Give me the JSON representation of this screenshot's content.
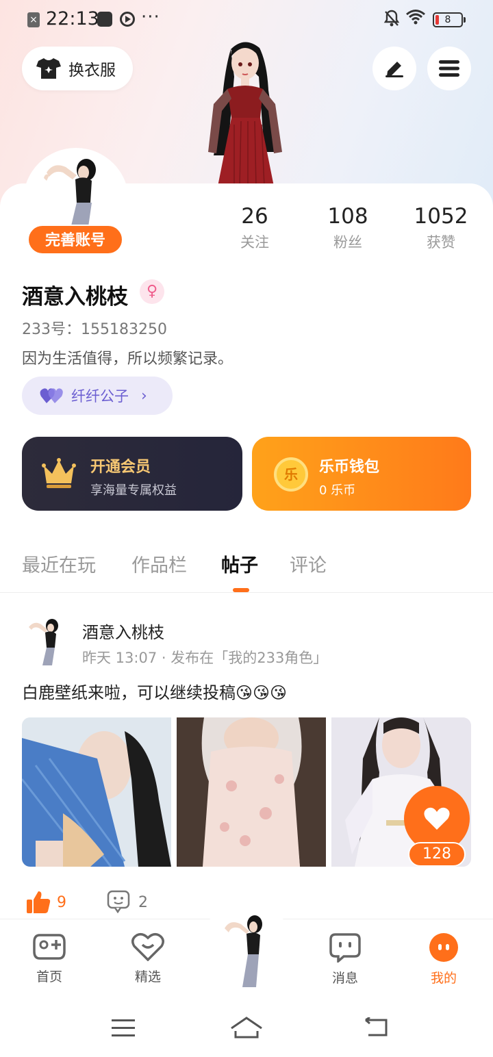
{
  "status_bar": {
    "time": "22:13",
    "dots": "···",
    "battery": "8"
  },
  "header": {
    "outfit_label": "换衣服",
    "edit_icon": "pencil-icon",
    "menu_icon": "hamburger-icon"
  },
  "profile": {
    "complete_account": "完善账号",
    "stats": [
      {
        "num": "26",
        "label": "关注"
      },
      {
        "num": "108",
        "label": "粉丝"
      },
      {
        "num": "1052",
        "label": "获赞"
      }
    ],
    "username": "酒意入桃枝",
    "gender_symbol": "♀",
    "uid": "233号：155183250",
    "bio": "因为生活值得，所以频繁记录。",
    "cp_label": "纤纤公子",
    "cp_chevron": "›"
  },
  "vip": {
    "title": "开通会员",
    "subtitle": "享海量专属权益"
  },
  "wallet": {
    "coin_char": "乐",
    "title": "乐币钱包",
    "subtitle": "0 乐币"
  },
  "tabs": [
    {
      "label": "最近在玩",
      "active": false
    },
    {
      "label": "作品栏",
      "active": false
    },
    {
      "label": "帖子",
      "active": true
    },
    {
      "label": "评论",
      "active": false
    }
  ],
  "post": {
    "author": "酒意入桃枝",
    "meta": "昨天 13:07 · 发布在「我的233角色」",
    "text": "白鹿壁纸来啦，可以继续投稿😘😘😘",
    "like_fab_count": "128",
    "likes": "9",
    "comments": "2"
  },
  "bottom_nav": [
    {
      "label": "首页",
      "icon": "gamepad-icon"
    },
    {
      "label": "精选",
      "icon": "heart-chat-icon"
    },
    {
      "label": "消息",
      "icon": "message-icon"
    },
    {
      "label": "我的",
      "icon": "face-icon",
      "active": true
    }
  ],
  "colors": {
    "accent": "#ff6f1a",
    "vip_gold": "#f7c873",
    "cp_purple": "#6b5ed1"
  }
}
